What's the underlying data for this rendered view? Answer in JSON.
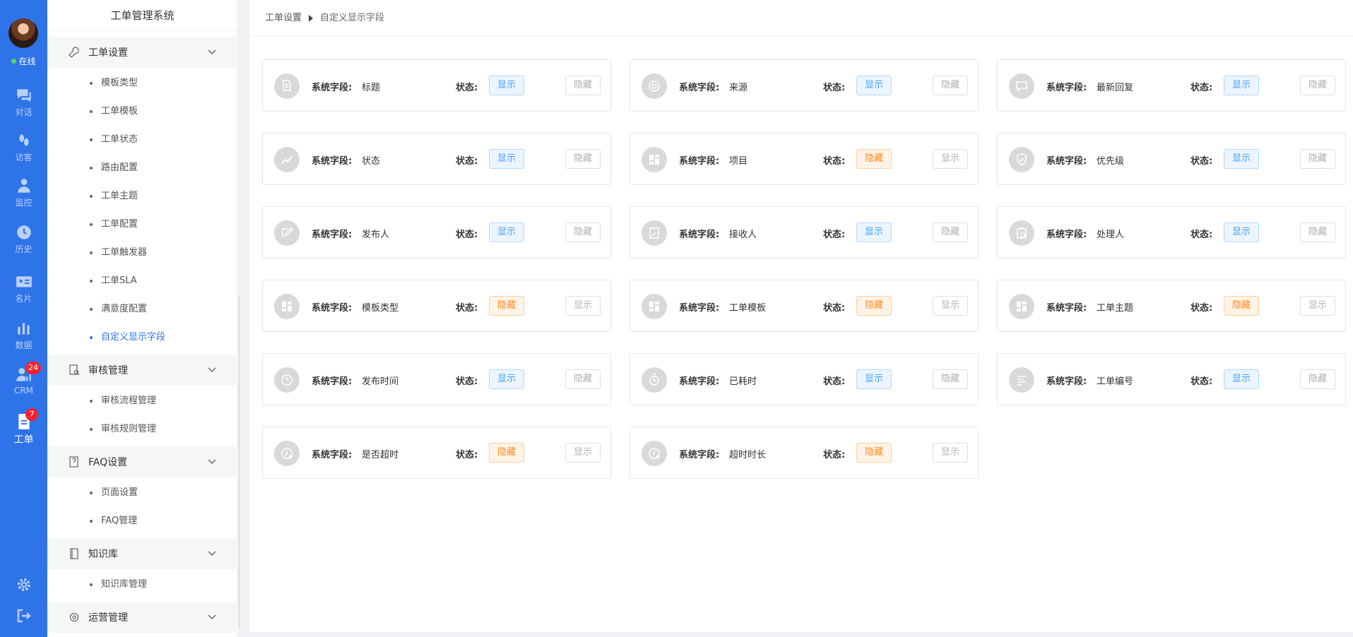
{
  "rail": {
    "status": "在线",
    "items": [
      {
        "label": "对话",
        "icon": "chat-icon"
      },
      {
        "label": "访客",
        "icon": "footprint-icon"
      },
      {
        "label": "监控",
        "icon": "monitor-icon"
      },
      {
        "label": "历史",
        "icon": "clock-icon"
      },
      {
        "label": "名片",
        "icon": "card-icon"
      },
      {
        "label": "数据",
        "icon": "bar-chart-icon"
      },
      {
        "label": "CRM",
        "icon": "crm-icon",
        "badge": "24"
      },
      {
        "label": "工单",
        "icon": "ticket-icon",
        "badge": "7",
        "active": true
      }
    ],
    "bottom": [
      "settings-icon",
      "logout-icon"
    ]
  },
  "nav": {
    "title": "工单管理系统",
    "groups": [
      {
        "label": "工单设置",
        "items": [
          "模板类型",
          "工单模板",
          "工单状态",
          "路由配置",
          "工单主题",
          "工单配置",
          "工单触发器",
          "工单SLA",
          "满意度配置",
          "自定义显示字段"
        ]
      },
      {
        "label": "审核管理",
        "items": [
          "审核流程管理",
          "审核规则管理"
        ]
      },
      {
        "label": "FAQ设置",
        "items": [
          "页面设置",
          "FAQ管理"
        ]
      },
      {
        "label": "知识库",
        "items": [
          "知识库管理"
        ]
      },
      {
        "label": "运营管理",
        "items": []
      }
    ],
    "active_item": "自定义显示字段"
  },
  "breadcrumb": {
    "parent": "工单设置",
    "current": "自定义显示字段"
  },
  "labels": {
    "field": "系统字段:",
    "status": "状态:",
    "show": "显示",
    "hide": "隐藏"
  },
  "fields": [
    {
      "name": "标题",
      "state": "显示",
      "toggle": "隐藏",
      "icon": "document-icon"
    },
    {
      "name": "来源",
      "state": "显示",
      "toggle": "隐藏",
      "icon": "target-icon"
    },
    {
      "name": "最新回复",
      "state": "显示",
      "toggle": "隐藏",
      "icon": "reply-icon"
    },
    {
      "name": "状态",
      "state": "显示",
      "toggle": "隐藏",
      "icon": "trend-icon"
    },
    {
      "name": "项目",
      "state": "隐藏",
      "toggle": "显示",
      "icon": "grid-icon"
    },
    {
      "name": "优先级",
      "state": "显示",
      "toggle": "隐藏",
      "icon": "shield-icon"
    },
    {
      "name": "发布人",
      "state": "显示",
      "toggle": "隐藏",
      "icon": "edit-icon"
    },
    {
      "name": "接收人",
      "state": "显示",
      "toggle": "隐藏",
      "icon": "receive-icon"
    },
    {
      "name": "处理人",
      "state": "显示",
      "toggle": "隐藏",
      "icon": "clipboard-icon"
    },
    {
      "name": "模板类型",
      "state": "隐藏",
      "toggle": "显示",
      "icon": "grid-icon"
    },
    {
      "name": "工单模板",
      "state": "隐藏",
      "toggle": "显示",
      "icon": "grid-icon"
    },
    {
      "name": "工单主题",
      "state": "隐藏",
      "toggle": "显示",
      "icon": "grid-icon"
    },
    {
      "name": "发布时间",
      "state": "显示",
      "toggle": "隐藏",
      "icon": "clock-icon"
    },
    {
      "name": "已耗时",
      "state": "显示",
      "toggle": "隐藏",
      "icon": "timer-icon"
    },
    {
      "name": "工单编号",
      "state": "显示",
      "toggle": "隐藏",
      "icon": "list-icon"
    },
    {
      "name": "是否超时",
      "state": "隐藏",
      "toggle": "显示",
      "icon": "alarm-icon"
    },
    {
      "name": "超时时长",
      "state": "隐藏",
      "toggle": "显示",
      "icon": "alarm-icon"
    }
  ],
  "colors": {
    "rail": "#2f73e8",
    "show": "#409eff",
    "hide": "#ff8a1f",
    "active_nav": "#2f73e8"
  }
}
